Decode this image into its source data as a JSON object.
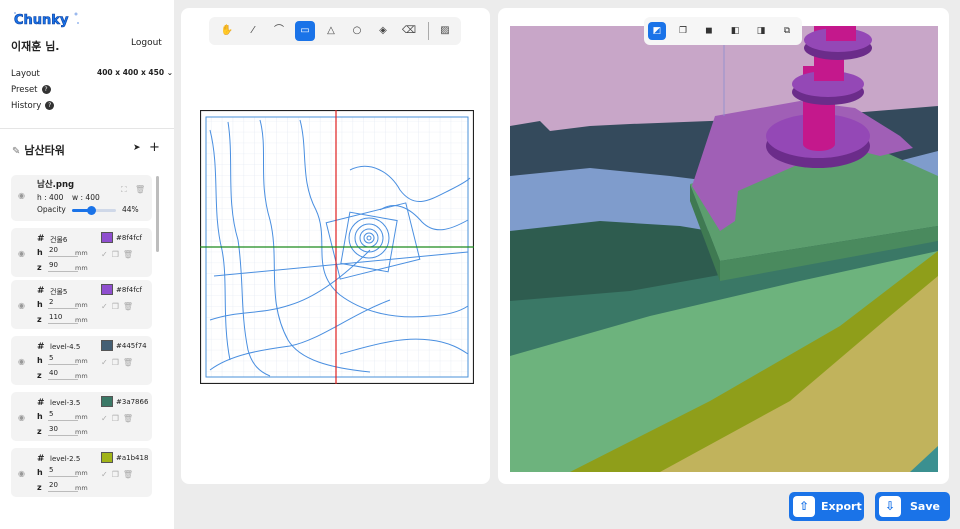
{
  "app": {
    "logo": "Chunky",
    "user_name": "이재훈 님.",
    "logout_label": "Logout"
  },
  "settings": {
    "layout_label": "Layout",
    "layout_value": "400 x 400 x 450",
    "preset_label": "Preset",
    "history_label": "History"
  },
  "project": {
    "title": "남산타워"
  },
  "image_layer": {
    "file": "남산.png",
    "h_label": "h : 400",
    "w_label": "w : 400",
    "opacity_label": "Opacity",
    "opacity_value": "44%",
    "opacity": 0.44
  },
  "layers": [
    {
      "name": "건물6",
      "h": "20",
      "z": "90",
      "color": "#8f4fcf"
    },
    {
      "name": "건물5",
      "h": "2",
      "z": "110",
      "color": "#8f4fcf"
    },
    {
      "name": "level-4.5",
      "h": "5",
      "z": "40",
      "color": "#445f74"
    },
    {
      "name": "level-3.5",
      "h": "5",
      "z": "30",
      "color": "#3a7866"
    },
    {
      "name": "level-2.5",
      "h": "5",
      "z": "20",
      "color": "#a1b418"
    }
  ],
  "layer_labels": {
    "hash": "#",
    "h": "h",
    "z": "z",
    "unit": "mm"
  },
  "draw_tools": [
    "hand-icon",
    "line-icon",
    "curve-icon",
    "rectangle-icon",
    "triangle-icon",
    "circle-icon",
    "fill-icon",
    "eraser-icon",
    "image-icon"
  ],
  "active_tool": "rectangle-icon",
  "view_tools": [
    "perspective-view-icon",
    "front-view-icon",
    "back-view-icon",
    "left-view-icon",
    "right-view-icon",
    "top-view-icon"
  ],
  "actions": {
    "export_label": "Export",
    "save_label": "Save"
  }
}
